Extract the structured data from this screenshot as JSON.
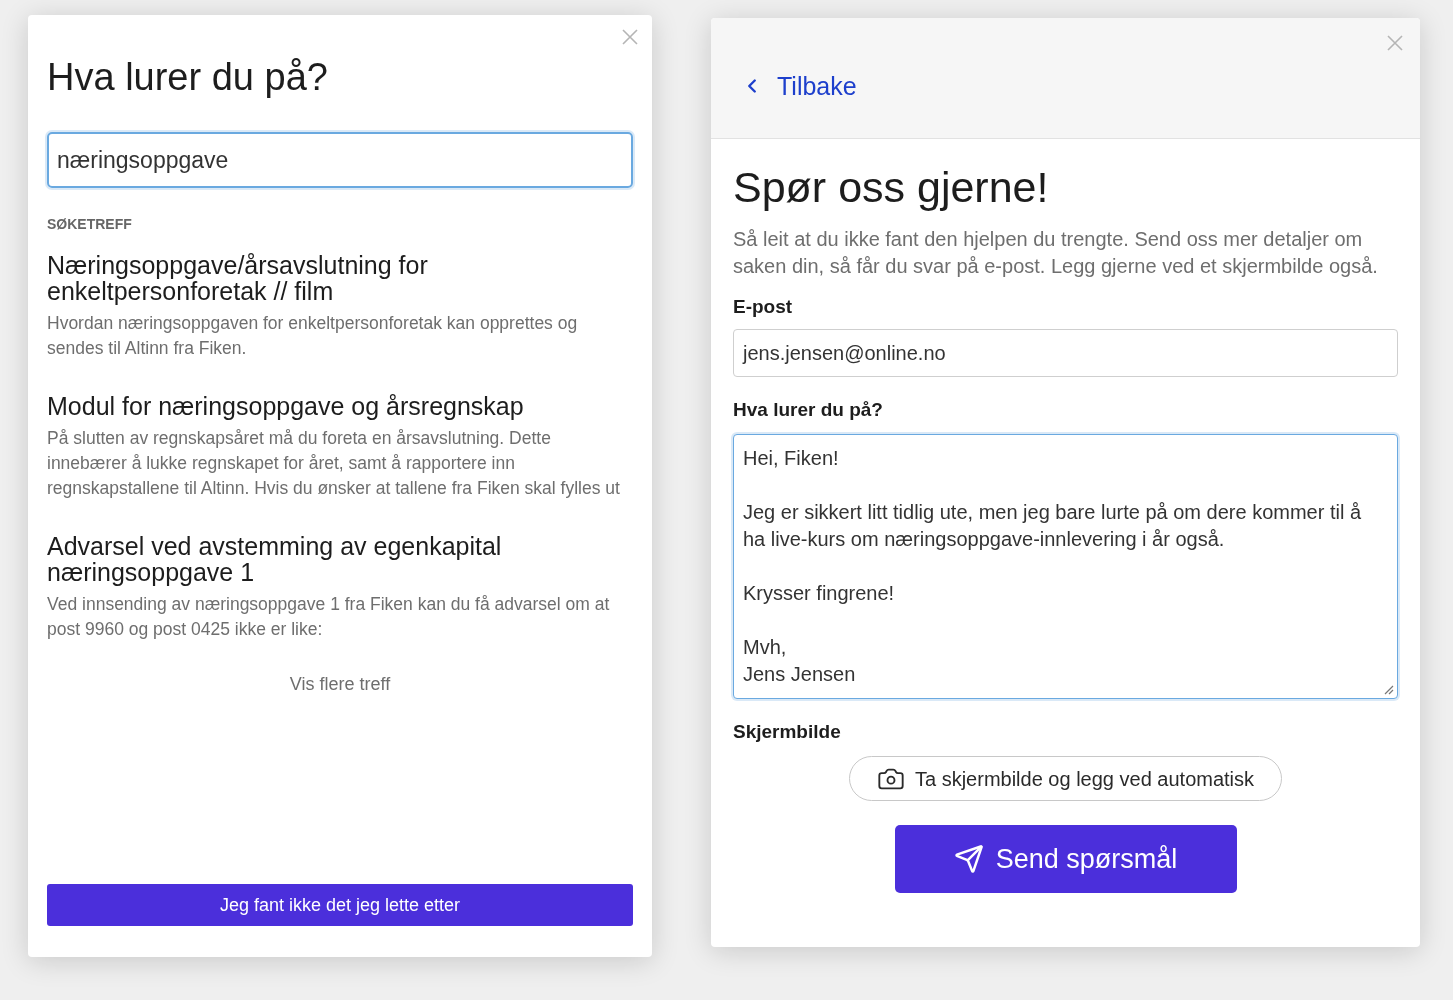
{
  "search_dialog": {
    "title": "Hva lurer du på?",
    "search": {
      "value": "næringsoppgave",
      "focused": true
    },
    "results_heading": "SØKETREFF",
    "results": [
      {
        "title": "Næringsoppgave/årsavslutning for enkeltpersonforetak // film",
        "description": "Hvordan næringsoppgaven for enkeltpersonforetak kan opprettes og sendes til Altinn fra Fiken."
      },
      {
        "title": "Modul for næringsoppgave og årsregnskap",
        "description": "På slutten av regnskapsåret må du foreta en årsavslutning. Dette innebærer å lukke regnskapet for året, samt å rapportere inn regnskapstallene til Altinn. Hvis du ønsker at tallene fra Fiken skal fylles ut"
      },
      {
        "title": "Advarsel ved avstemming av egenkapital næringsoppgave 1",
        "description": "Ved innsending av næringsoppgave 1 fra Fiken kan du få advarsel om at post 9960 og post 0425 ikke er like:"
      }
    ],
    "more_link": "Vis flere treff",
    "not_found_button": "Jeg fant ikke det jeg lette etter"
  },
  "contact_dialog": {
    "back_link": "Tilbake",
    "title": "Spør oss gjerne!",
    "intro": "Så leit at du ikke fant den hjelpen du trengte. Send oss mer detaljer om saken din, så får du svar på e-post. Legg gjerne ved et skjermbilde også.",
    "fields": [
      {
        "label": "E-post",
        "kind": "input",
        "value": "jens.jensen@online.no",
        "focused": false
      },
      {
        "label": "Hva lurer du på?",
        "kind": "textarea",
        "value": "Hei, Fiken!\n\nJeg er sikkert litt tidlig ute, men jeg bare lurte på om dere kommer til å ha live-kurs om næringsoppgave-innlevering i år også.\n\nKrysser fingrene!\n\nMvh,\nJens Jensen",
        "focused": true
      }
    ],
    "screenshot": {
      "label": "Skjermbilde",
      "button": "Ta skjermbilde og legg ved automatisk"
    },
    "submit_button": "Send spørsmål"
  }
}
